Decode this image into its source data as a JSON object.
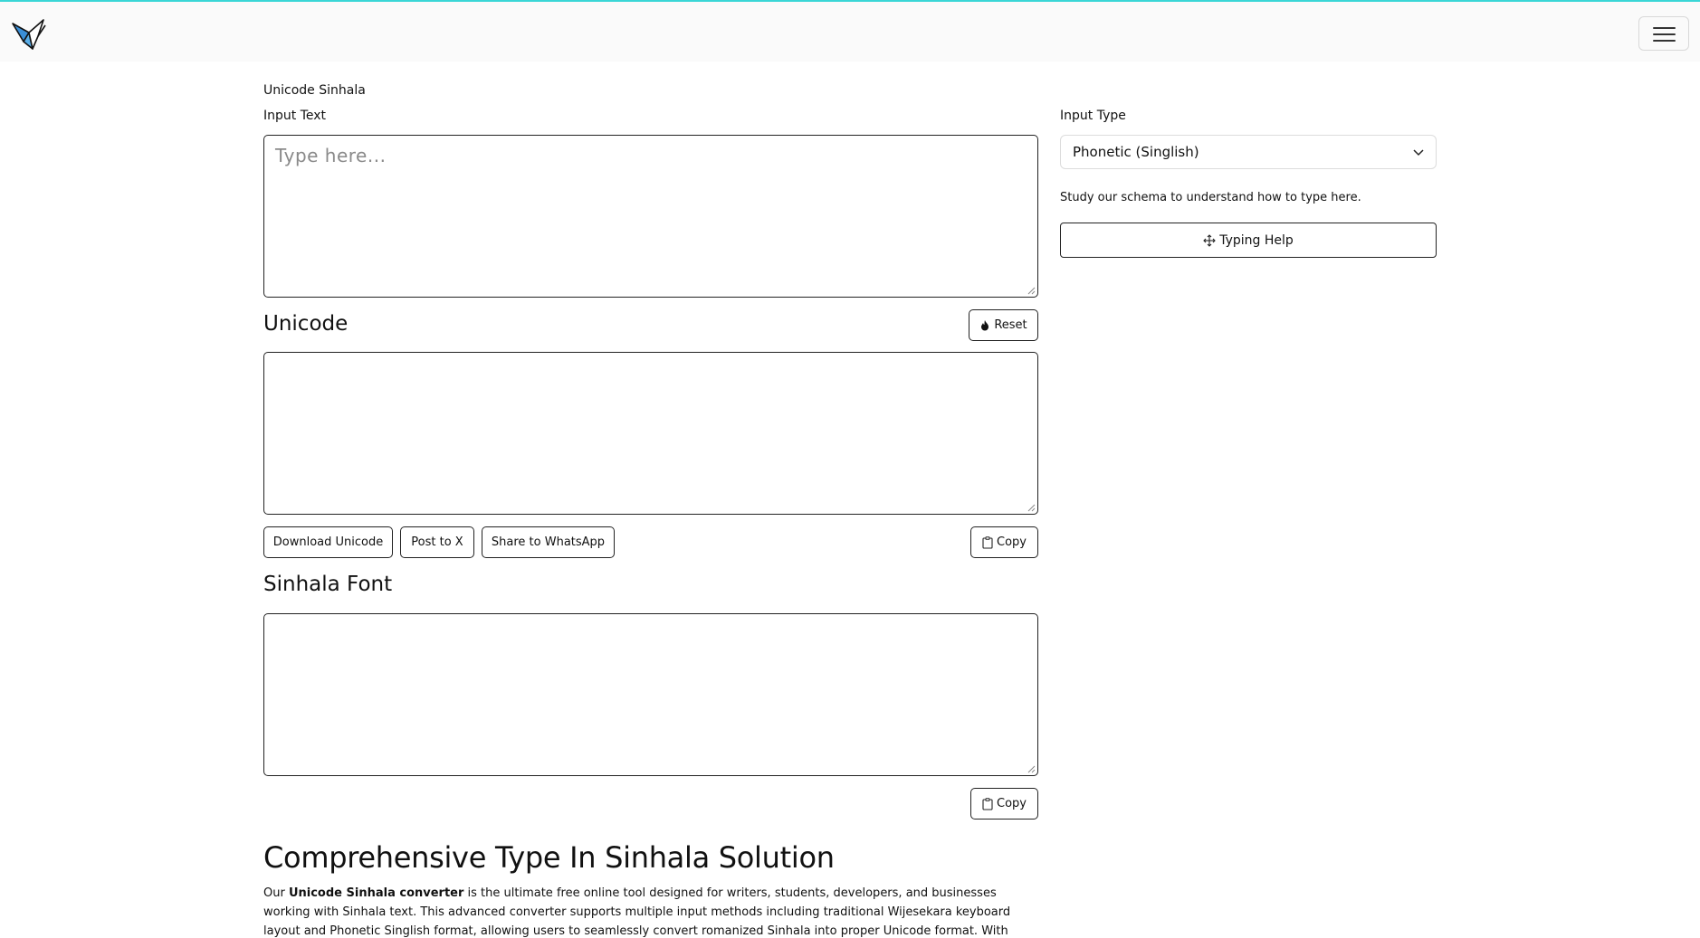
{
  "nav": {
    "logo_icon": "origami-bird-icon",
    "menu_icon": "hamburger-icon"
  },
  "colors": {
    "accent_line": "#3ad6d6",
    "logo_blue": "#3a8fd8"
  },
  "page_label": "Unicode Sinhala",
  "input": {
    "label": "Input Text",
    "placeholder": "Type  here..."
  },
  "input_type": {
    "label": "Input Type",
    "selected": "Phonetic (Singlish)",
    "help_text": "Study our schema to understand how to type here.",
    "help_button": "Typing Help",
    "help_icon": "move-arrows-icon"
  },
  "unicode": {
    "heading": "Unicode",
    "reset_button": "Reset",
    "reset_icon": "fire-icon",
    "download_button": "Download Unicode",
    "post_x_button": "Post to X",
    "whatsapp_button": "Share to WhatsApp",
    "copy_button": "Copy",
    "copy_icon": "clipboard-icon"
  },
  "sinhala_font": {
    "heading": "Sinhala Font",
    "copy_button": "Copy"
  },
  "article": {
    "heading": "Comprehensive Type In Sinhala Solution",
    "p_start": "Our ",
    "p_bold": "Unicode Sinhala converter",
    "p_rest": " is the ultimate free online tool designed for writers, students, developers, and businesses working with Sinhala text. This advanced converter supports multiple input methods including traditional Wijesekara keyboard layout and Phonetic Singlish format, allowing users to seamlessly convert romanized Sinhala into proper Unicode format. With real-time conversion"
  }
}
